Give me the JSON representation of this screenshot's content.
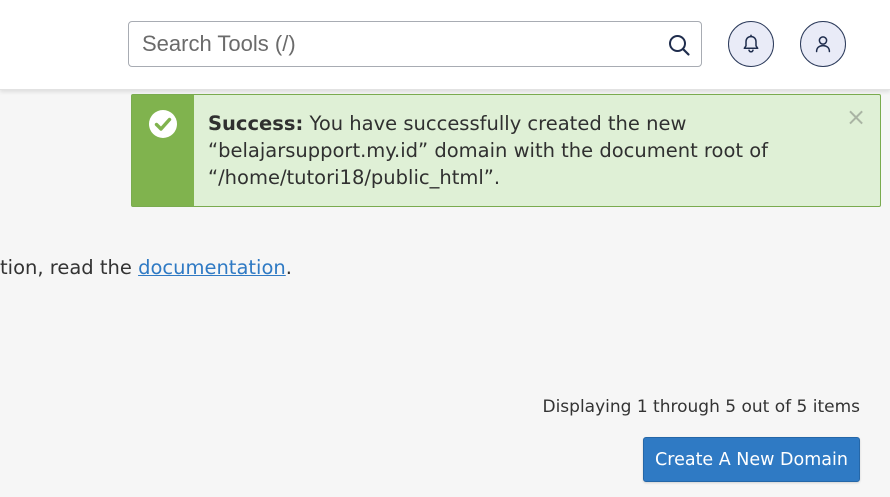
{
  "header": {
    "search": {
      "placeholder": "Search Tools (/)",
      "value": ""
    },
    "icons": {
      "search": "search-icon",
      "notifications": "bell-icon",
      "user": "user-icon"
    }
  },
  "alert": {
    "type": "success",
    "label": "Success:",
    "message": "You have successfully created the new “belajarsupport.my.id” domain with the document root of “/home/tutori18/public_html”.",
    "close": "×",
    "colors": {
      "side": "#80b34e",
      "background": "#dff0d6",
      "border": "#7aab4f"
    }
  },
  "intro": {
    "prefix": "tion, read the ",
    "link_text": "documentation",
    "suffix": "."
  },
  "listing": {
    "displaying_text": "Displaying 1 through 5 out of 5 items"
  },
  "actions": {
    "create_domain_label": "Create A New Domain",
    "accent_color": "#2f7ac4"
  }
}
